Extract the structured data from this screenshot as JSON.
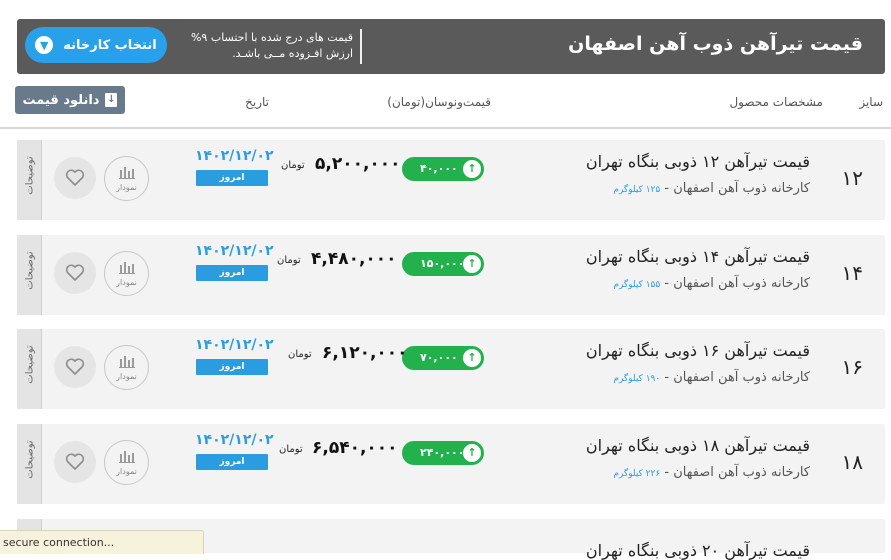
{
  "header": {
    "title": "قیمت تیرآهن ذوب آهن اصفهان",
    "note": "قیمت های درج شده با احتساب ۹% ارزش افـزوده مــی باشـد.",
    "factory_button": "انتخاب کارخانه"
  },
  "table_head": {
    "size": "سایز",
    "specs": "مشخصات محصول",
    "price": "قیمت‌ونوسان(تومان)",
    "date": "تاریخ",
    "download_button": "دانلود قیمت"
  },
  "rows": [
    {
      "size": "۱۲",
      "title": "قیمت تیرآهن ۱۲ ذوبی بنگاه تهران",
      "factory": "کارخانه ذوب آهن اصفهان - ",
      "weight": "۱۲۵ کیلوگرم",
      "change": "۴۰,۰۰۰",
      "price": "۵,۲۰۰,۰۰۰",
      "unit": "تومان",
      "date": "۱۴۰۲/۱۲/۰۲",
      "today": "امروز",
      "chart_label": "نمودار",
      "desc": "توضیحات"
    },
    {
      "size": "۱۴",
      "title": "قیمت تیرآهن ۱۴ ذوبی بنگاه تهران",
      "factory": "کارخانه ذوب آهن اصفهان - ",
      "weight": "۱۵۵ کیلوگرم",
      "change": "۱۵۰,۰۰۰",
      "price": "۴,۴۸۰,۰۰۰",
      "unit": "تومان",
      "date": "۱۴۰۲/۱۲/۰۲",
      "today": "امروز",
      "chart_label": "نمودار",
      "desc": "توضیحات"
    },
    {
      "size": "۱۶",
      "title": "قیمت تیرآهن ۱۶ ذوبی بنگاه تهران",
      "factory": "کارخانه ذوب آهن اصفهان - ",
      "weight": "۱۹۰ کیلوگرم",
      "change": "۷۰,۰۰۰",
      "price": "۶,۱۲۰,۰۰۰",
      "unit": "تومان",
      "date": "۱۴۰۲/۱۲/۰۲",
      "today": "امروز",
      "chart_label": "نمودار",
      "desc": "توضیحات"
    },
    {
      "size": "۱۸",
      "title": "قیمت تیرآهن ۱۸ ذوبی بنگاه تهران",
      "factory": "کارخانه ذوب آهن اصفهان - ",
      "weight": "۲۲۶ کیلوگرم",
      "change": "۲۴۰,۰۰۰",
      "price": "۶,۵۴۰,۰۰۰",
      "unit": "تومان",
      "date": "۱۴۰۲/۱۲/۰۲",
      "today": "امروز",
      "chart_label": "نمودار",
      "desc": "توضیحات"
    }
  ],
  "partial_row": {
    "title": "قیمت تیرآهن ۲۰ ذوبی بنگاه تهران"
  },
  "status_bar": "secure connection..."
}
